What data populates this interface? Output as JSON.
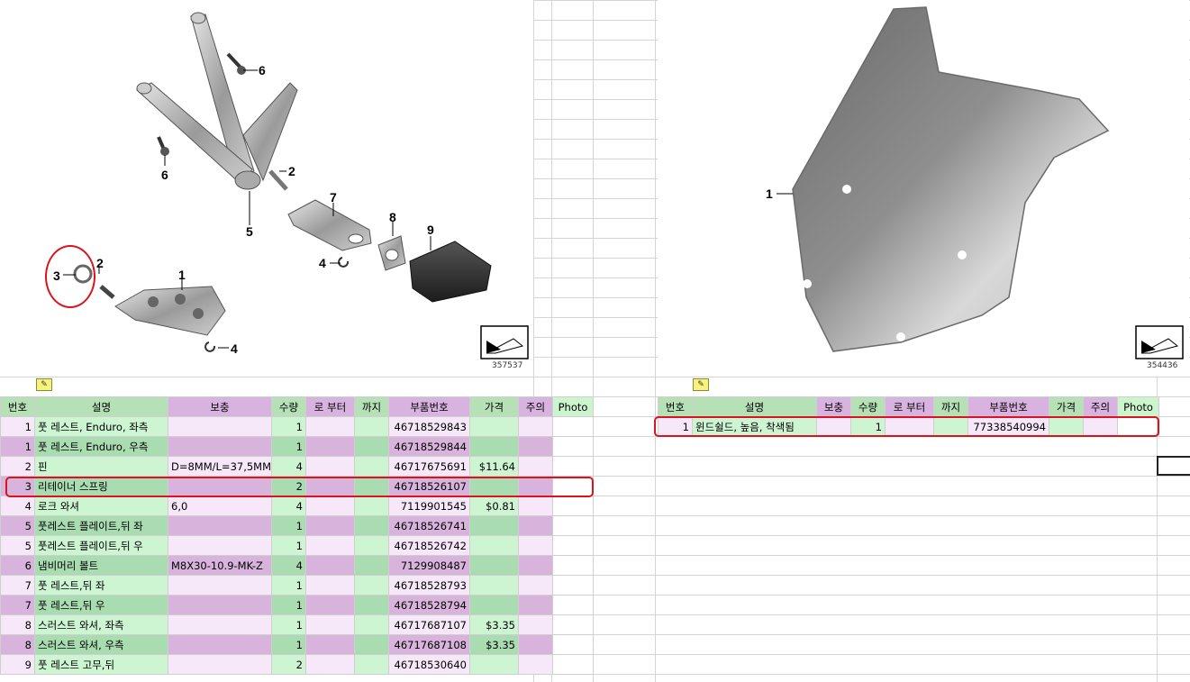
{
  "left_diagram": {
    "callouts": [
      "6",
      "6",
      "2",
      "7",
      "8",
      "9",
      "5",
      "4",
      "3",
      "2",
      "1",
      "4"
    ],
    "ref_number": "357537"
  },
  "right_diagram": {
    "callouts": [
      "1"
    ],
    "ref_number": "354436"
  },
  "note_icon": "note-icon",
  "left_table": {
    "headers": [
      "번호",
      "설명",
      "보충",
      "수량",
      "로 부터",
      "까지",
      "부품번호",
      "가격",
      "주의",
      "Photo"
    ],
    "rows": [
      [
        "1",
        "풋 레스트, Enduro, 좌측",
        "",
        "1",
        "",
        "",
        "46718529843",
        "",
        ""
      ],
      [
        "1",
        "풋 레스트, Enduro, 우측",
        "",
        "1",
        "",
        "",
        "46718529844",
        "",
        ""
      ],
      [
        "2",
        "핀",
        "D=8MM/L=37,5MM",
        "4",
        "",
        "",
        "46717675691",
        "$11.64",
        ""
      ],
      [
        "3",
        "리테이너 스프링",
        "",
        "2",
        "",
        "",
        "46718526107",
        "",
        ""
      ],
      [
        "4",
        "로크 와셔",
        "6,0",
        "4",
        "",
        "",
        "7119901545",
        "$0.81",
        ""
      ],
      [
        "5",
        "풋레스트 플레이트,뒤 좌",
        "",
        "1",
        "",
        "",
        "46718526741",
        "",
        ""
      ],
      [
        "5",
        "풋레스트 플레이트,뒤 우",
        "",
        "1",
        "",
        "",
        "46718526742",
        "",
        ""
      ],
      [
        "6",
        "냄비머리 볼트",
        "M8X30-10.9-MK-Z",
        "4",
        "",
        "",
        "7129908487",
        "",
        ""
      ],
      [
        "7",
        "풋 레스트,뒤 좌",
        "",
        "1",
        "",
        "",
        "46718528793",
        "",
        ""
      ],
      [
        "7",
        "풋 레스트,뒤 우",
        "",
        "1",
        "",
        "",
        "46718528794",
        "",
        ""
      ],
      [
        "8",
        "스러스트 와셔, 좌측",
        "",
        "1",
        "",
        "",
        "46717687107",
        "$3.35",
        ""
      ],
      [
        "8",
        "스러스트 와셔, 우측",
        "",
        "1",
        "",
        "",
        "46717687108",
        "$3.35",
        ""
      ],
      [
        "9",
        "풋 레스트 고무,뒤",
        "",
        "2",
        "",
        "",
        "46718530640",
        "",
        ""
      ]
    ]
  },
  "right_table": {
    "headers": [
      "번호",
      "설명",
      "보충",
      "수량",
      "로 부터",
      "까지",
      "부품번호",
      "가격",
      "주의",
      "Photo"
    ],
    "rows": [
      [
        "1",
        "윈드쉴드, 높음, 착색됨",
        "",
        "1",
        "",
        "",
        "77338540994",
        "",
        ""
      ]
    ]
  },
  "colors": {
    "highlight": "#d9141e",
    "header_green": "#b6e0b6",
    "header_purple": "#d9b3e0"
  }
}
